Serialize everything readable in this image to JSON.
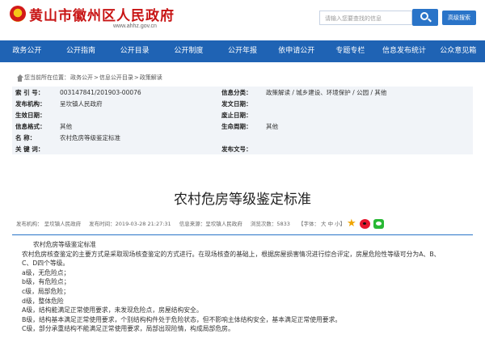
{
  "header": {
    "site_title": "黄山市徽州区人民政府",
    "site_url": "www.ahhz.gov.cn",
    "search_placeholder": "请输入您要查找的信息",
    "advanced_search_label": "高级搜索"
  },
  "nav": {
    "items": [
      "政务公开",
      "公开指南",
      "公开目录",
      "公开制度",
      "公开年报",
      "依申请公开",
      "专题专栏",
      "信息发布统计",
      "公众意见箱"
    ]
  },
  "breadcrumb": {
    "prefix": "您当前所在位置：",
    "items": [
      "政务公开",
      "信息公开目录",
      "政策解读"
    ],
    "separator": " > "
  },
  "info": {
    "index_label": "索 引 号：",
    "index_value": "003147841/201903-00076",
    "category_label": "信息分类：",
    "category_value": "政策解读 / 城乡建设、环境保护 / 公园 / 其他",
    "publisher_label": "发布机构：",
    "publisher_value": "呈坎镇人民政府",
    "doc_no_label": "发文日期：",
    "doc_no_value": "",
    "created_label": "生效日期：",
    "created_value": "",
    "abolish_label": "废止日期：",
    "abolish_value": "",
    "format_label": "信息格式：",
    "format_value": "其他",
    "lifecycle_label": "生命周期：",
    "lifecycle_value": "其他",
    "name_label": "名    称：",
    "name_value": "农村危房等级鉴定标准",
    "keywords_label": "关 键 词：",
    "keywords_value": "",
    "doc_label": "发布文号：",
    "doc_value": ""
  },
  "article": {
    "title": "农村危房等级鉴定标准",
    "meta_publisher": "发布机构： 呈坎镇人民政府",
    "meta_time": "发布时间：2019-03-28 21:27:31",
    "meta_source": "信息来源：呈坎镇人民政府",
    "meta_views": "浏览次数：5833",
    "font_size_label": "【字体： 大 中 小】",
    "paragraphs": [
      "农村危房等级鉴定标准",
      "农村危房核查鉴定的主要方式是采取现场核查鉴定的方式进行。在现场核查的基础上，根据房屋损害情况进行综合评定，房屋危险性等级可分为A、B、",
      "C、D四个等级。",
      "a级，无危险点；",
      "b级，有危险点；",
      "c级，局部危险；",
      "d级，整体危险",
      "A级，结构能满足正常使用要求，未发现危险点，房屋结构安全。",
      "B级，结构基本满足正常使用要求，个别结构构件处于危险状态，但不影响主体结构安全，基本满足正常使用要求。",
      "C级，部分承重结构不能满足正常使用要求，局部出现险情，构成局部危房。"
    ]
  }
}
